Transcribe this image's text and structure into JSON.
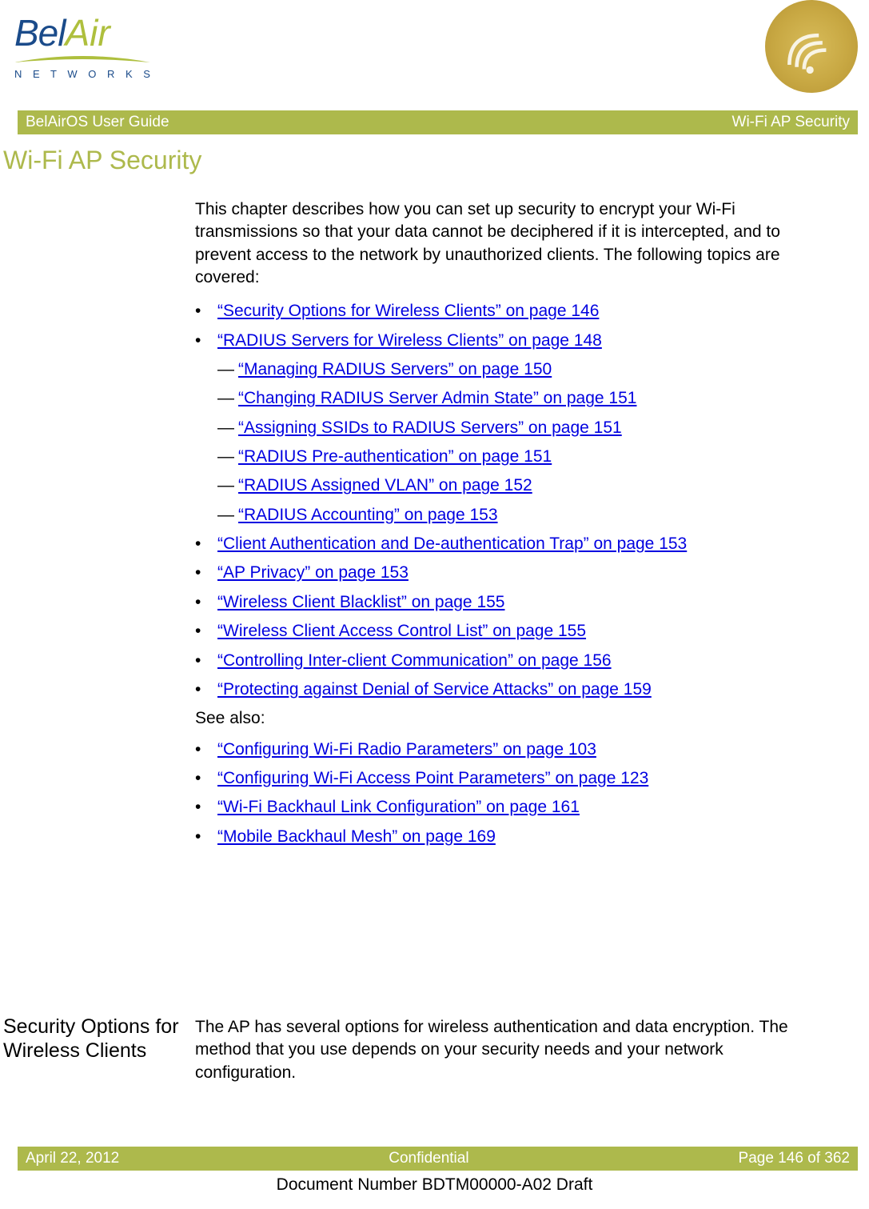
{
  "logo": {
    "brand1": "Bel",
    "brand2": "Air",
    "sub": "N E T W O R K S"
  },
  "header": {
    "left": "BelAirOS User Guide",
    "right": "Wi-Fi AP Security"
  },
  "title": "Wi-Fi AP Security",
  "intro": "This chapter describes how you can set up security to encrypt your Wi-Fi transmissions so that your data cannot be deciphered if it is intercepted, and to prevent access to the network by unauthorized clients. The following topics are covered:",
  "toc": [
    {
      "text": "“Security Options for Wireless Clients” on page 146",
      "level": 0
    },
    {
      "text": "“RADIUS Servers for Wireless Clients” on page 148",
      "level": 0
    },
    {
      "text": "“Managing RADIUS Servers” on page 150",
      "level": 1
    },
    {
      "text": "“Changing RADIUS Server Admin State” on page 151",
      "level": 1
    },
    {
      "text": "“Assigning SSIDs to RADIUS Servers” on page 151",
      "level": 1
    },
    {
      "text": "“RADIUS Pre-authentication” on page 151",
      "level": 1
    },
    {
      "text": "“RADIUS Assigned VLAN” on page 152",
      "level": 1
    },
    {
      "text": "“RADIUS Accounting” on page 153",
      "level": 1
    },
    {
      "text": "“Client Authentication and De-authentication Trap” on page 153",
      "level": 0
    },
    {
      "text": "“AP Privacy” on page 153",
      "level": 0
    },
    {
      "text": "“Wireless Client Blacklist” on page 155",
      "level": 0
    },
    {
      "text": "“Wireless Client Access Control List” on page 155",
      "level": 0
    },
    {
      "text": "“Controlling Inter-client Communication” on page 156",
      "level": 0
    },
    {
      "text": "“Protecting against Denial of Service Attacks” on page 159",
      "level": 0
    }
  ],
  "see_also_label": "See also:",
  "see_also": [
    {
      "text": "“Configuring Wi-Fi Radio Parameters” on page 103"
    },
    {
      "text": "“Configuring Wi-Fi Access Point Parameters” on page 123"
    },
    {
      "text": "“Wi-Fi Backhaul Link Configuration” on page 161"
    },
    {
      "text": "“Mobile Backhaul Mesh” on page 169"
    }
  ],
  "section": {
    "heading": "Security Options for Wireless Clients",
    "body": "The AP has several options for wireless authentication and data encryption. The method that you use depends on your security needs and your network configuration."
  },
  "footer": {
    "left": "April 22, 2012",
    "center": "Confidential",
    "right": "Page 146 of 362"
  },
  "docnum": "Document Number BDTM00000-A02 Draft",
  "glyphs": {
    "bullet": "•",
    "dash": "—"
  }
}
